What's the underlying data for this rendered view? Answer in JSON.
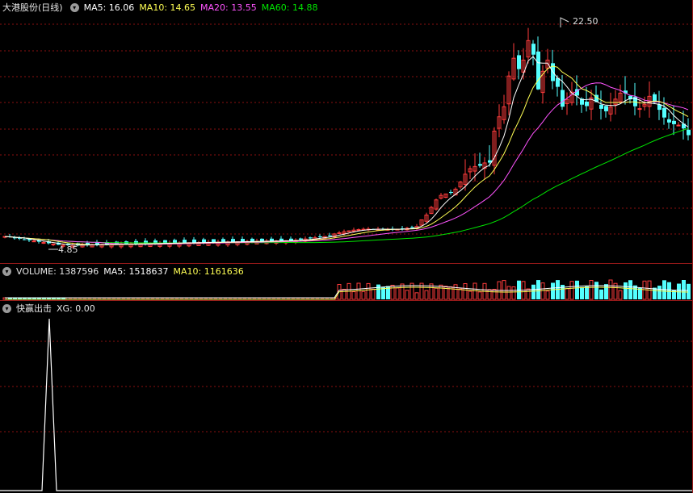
{
  "main": {
    "title": "大港股份(日线)",
    "ma5_label": "MA5: 16.06",
    "ma10_label": "MA10: 14.65",
    "ma20_label": "MA20: 13.55",
    "ma60_label": "MA60: 14.88",
    "high_label": "22.50",
    "low_label": "4.85"
  },
  "volume": {
    "label": "VOLUME: 1387596",
    "ma5_label": "MA5: 1518637",
    "ma10_label": "MA10: 1161636"
  },
  "indicator": {
    "title": "快赢出击",
    "xg_label": "XG: 0.00"
  },
  "colors": {
    "up": "#ff3c3c",
    "down": "#54ffff",
    "ma5": "#ffffff",
    "ma10": "#ffff54",
    "ma20": "#ff54ff",
    "ma60": "#00e600",
    "grid": "#8a1010"
  },
  "chart_data": [
    {
      "type": "candlestick",
      "title": "大港股份(日线)",
      "series": [
        {
          "name": "MA5",
          "values": [
            16.06
          ]
        },
        {
          "name": "MA10",
          "values": [
            14.65
          ]
        },
        {
          "name": "MA20",
          "values": [
            13.55
          ]
        },
        {
          "name": "MA60",
          "values": [
            14.88
          ]
        }
      ],
      "high": 22.5,
      "low": 4.85,
      "ylim": [
        4.0,
        23.0
      ]
    },
    {
      "type": "bar",
      "title": "VOLUME",
      "series": [
        {
          "name": "VOLUME",
          "values": [
            1387596
          ]
        },
        {
          "name": "MA5",
          "values": [
            1518637
          ]
        },
        {
          "name": "MA10",
          "values": [
            1161636
          ]
        }
      ]
    },
    {
      "type": "line",
      "title": "快赢出击",
      "series": [
        {
          "name": "XG",
          "values": [
            0.0
          ]
        }
      ]
    }
  ]
}
